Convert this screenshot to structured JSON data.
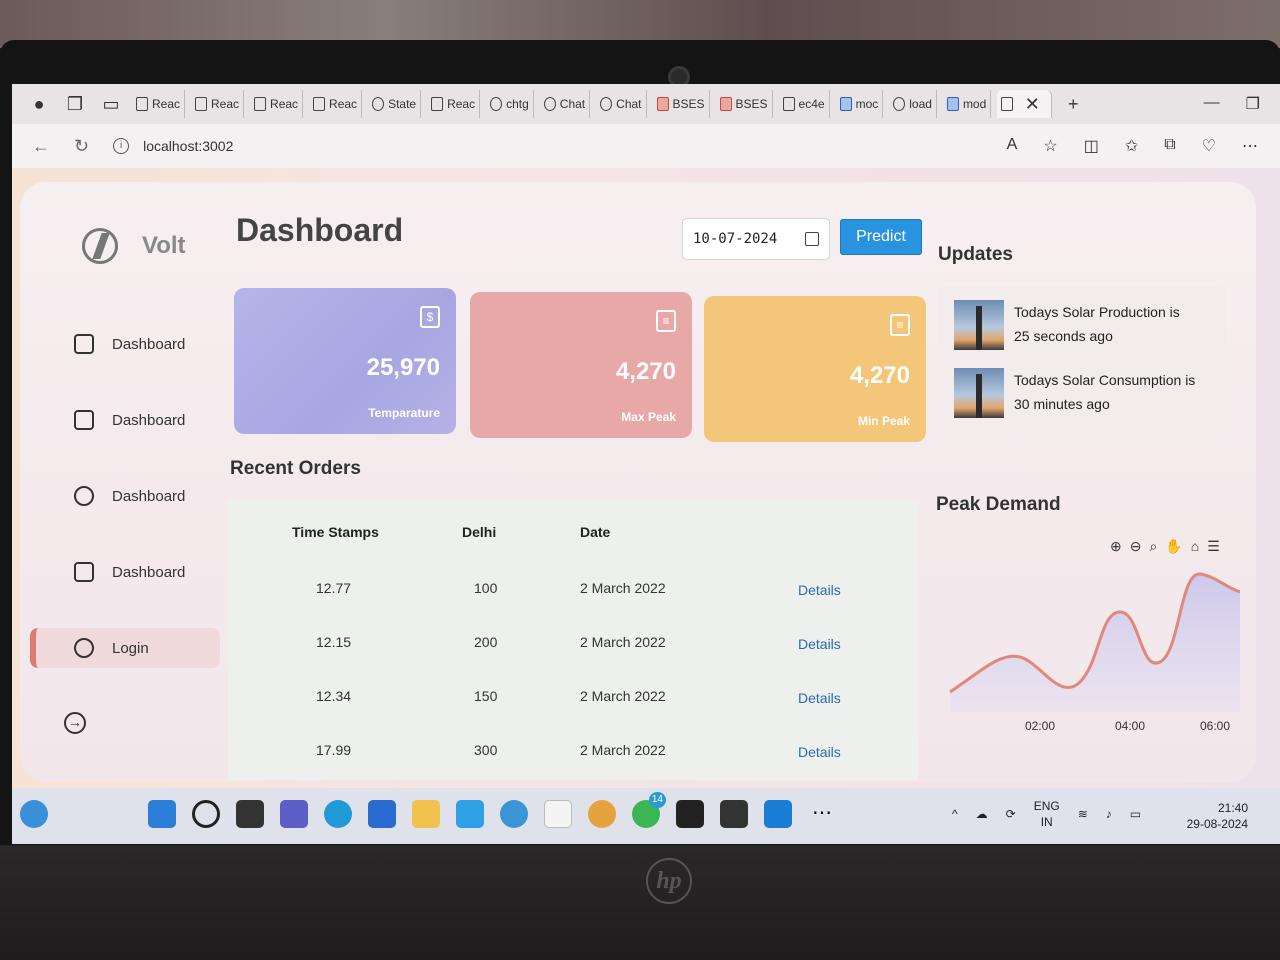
{
  "browser": {
    "tabs": [
      "Reac",
      "Reac",
      "Reac",
      "Reac",
      "State",
      "Reac",
      "chtg",
      "Chat",
      "Chat",
      "BSES",
      "BSES",
      "ec4e",
      "moc",
      "load",
      "mod"
    ],
    "url": "localhost:3002"
  },
  "sidebar": {
    "brand": "Volt",
    "items": [
      {
        "label": "Dashboard",
        "icon": "home-icon"
      },
      {
        "label": "Dashboard",
        "icon": "clipboard-icon"
      },
      {
        "label": "Dashboard",
        "icon": "users-icon"
      },
      {
        "label": "Dashboard",
        "icon": "save-icon"
      },
      {
        "label": "Login",
        "icon": "user-circle-icon"
      }
    ]
  },
  "main": {
    "title": "Dashboard",
    "date_value": "10-07-2024",
    "predict_label": "Predict",
    "cards": [
      {
        "value": "25,970",
        "label": "Temparature",
        "icon": "dollar-icon"
      },
      {
        "value": "4,270",
        "label": "Max Peak",
        "icon": "clipboard-icon"
      },
      {
        "value": "4,270",
        "label": "Min Peak",
        "icon": "clipboard-icon"
      }
    ],
    "orders_title": "Recent Orders",
    "table": {
      "headers": [
        "Time Stamps",
        "Delhi",
        "Date"
      ],
      "rows": [
        {
          "ts": "12.77",
          "delhi": "100",
          "date": "2 March 2022",
          "action": "Details"
        },
        {
          "ts": "12.15",
          "delhi": "200",
          "date": "2 March 2022",
          "action": "Details"
        },
        {
          "ts": "12.34",
          "delhi": "150",
          "date": "2 March 2022",
          "action": "Details"
        },
        {
          "ts": "17.99",
          "delhi": "300",
          "date": "2 March 2022",
          "action": "Details"
        }
      ]
    }
  },
  "updates": {
    "title": "Updates",
    "items": [
      {
        "line1": "Todays Solar Production is",
        "line2": "25 seconds ago"
      },
      {
        "line1": "Todays Solar Consumption is",
        "line2": "30 minutes ago"
      }
    ]
  },
  "peak": {
    "title": "Peak Demand",
    "ticks": [
      "02:00",
      "04:00",
      "06:00"
    ]
  },
  "taskbar": {
    "badge_whatsapp": "14",
    "lang": "ENG",
    "region": "IN",
    "time": "21:40",
    "date": "29-08-2024"
  },
  "colors": {
    "accent": "#2a93e0",
    "card_temp": "#aaaae4",
    "card_max": "#e9a8a8",
    "card_min": "#f4c67a",
    "chart_line": "#e0897a",
    "chart_fill": "#c9c4ec"
  }
}
